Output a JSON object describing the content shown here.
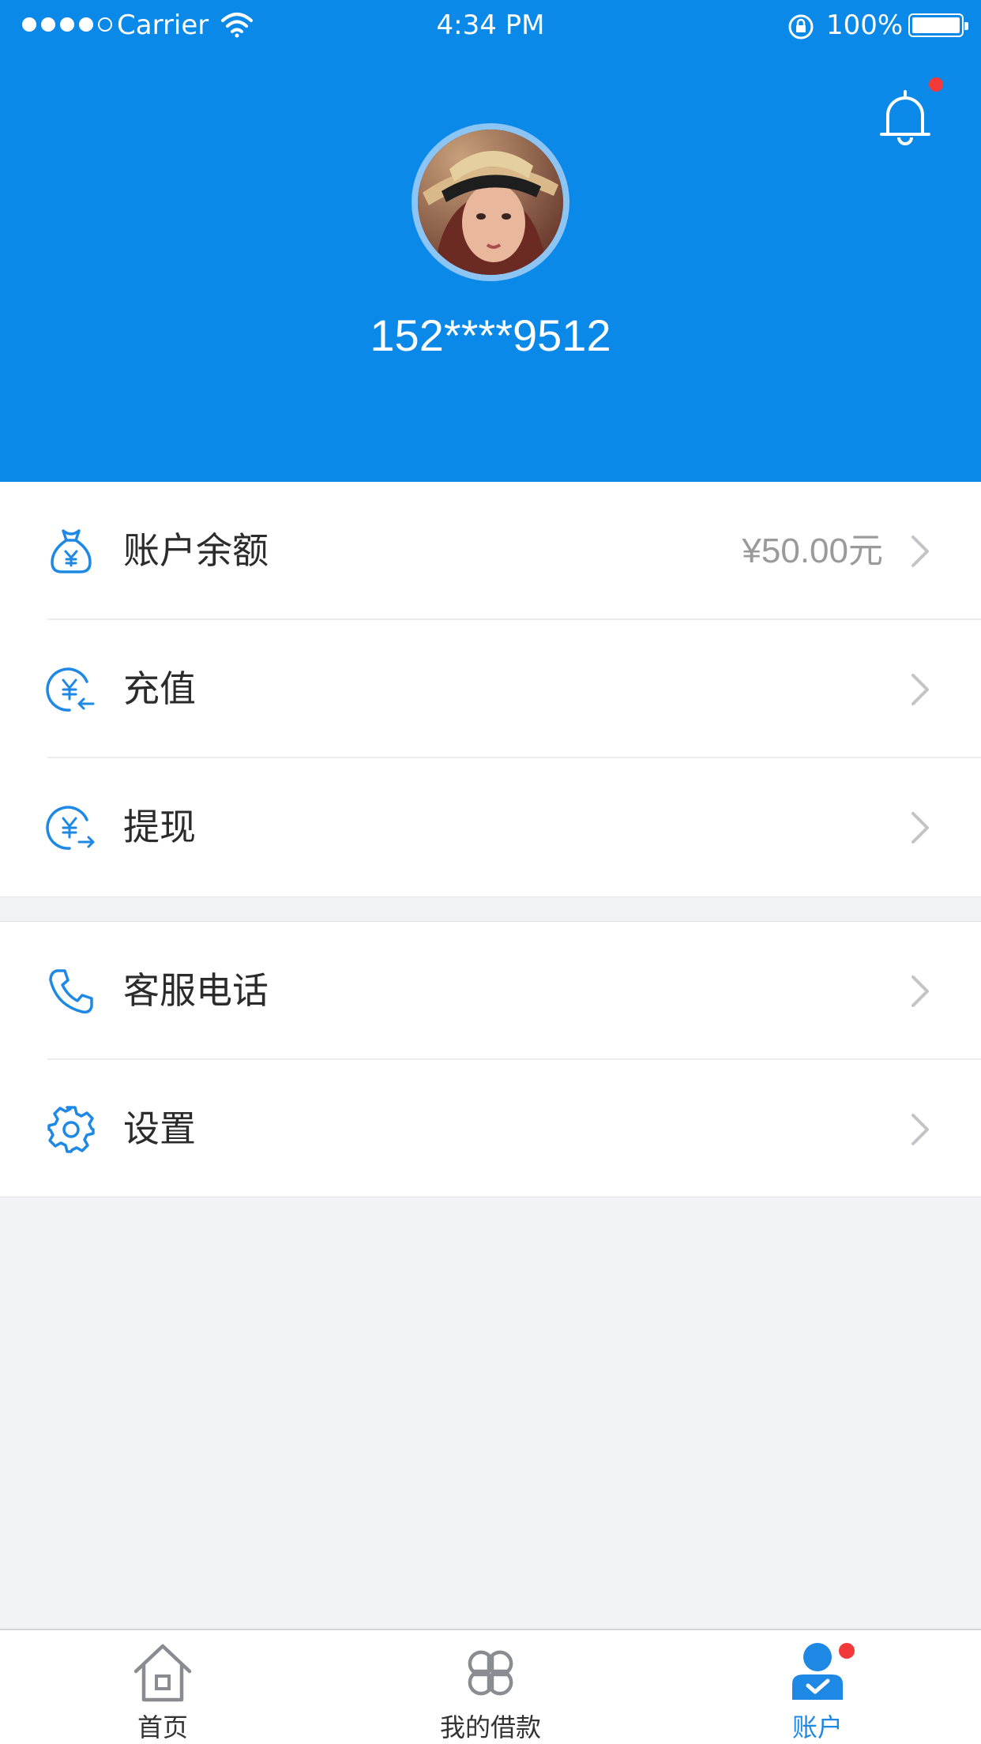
{
  "status_bar": {
    "carrier": "Carrier",
    "time": "4:34 PM",
    "battery": "100%"
  },
  "profile": {
    "phone": "152****9512",
    "avatar": "user-avatar-photo"
  },
  "menu_group_1": [
    {
      "label": "账户余额",
      "value": "¥50.00元",
      "icon": "money-bag-icon"
    },
    {
      "label": "充值",
      "value": "",
      "icon": "recharge-yuan-icon"
    },
    {
      "label": "提现",
      "value": "",
      "icon": "withdraw-yuan-icon"
    }
  ],
  "menu_group_2": [
    {
      "label": "客服电话",
      "icon": "phone-icon"
    },
    {
      "label": "设置",
      "icon": "gear-icon"
    }
  ],
  "tabbar": [
    {
      "label": "首页",
      "icon": "home-icon",
      "active": false
    },
    {
      "label": "我的借款",
      "icon": "clover-grid-icon",
      "active": false
    },
    {
      "label": "账户",
      "icon": "user-account-icon",
      "active": true
    }
  ],
  "colors": {
    "header_bg": "#0b89e8",
    "accent": "#1e88e5",
    "badge": "#f23a3a",
    "page_bg": "#f2f3f7"
  }
}
